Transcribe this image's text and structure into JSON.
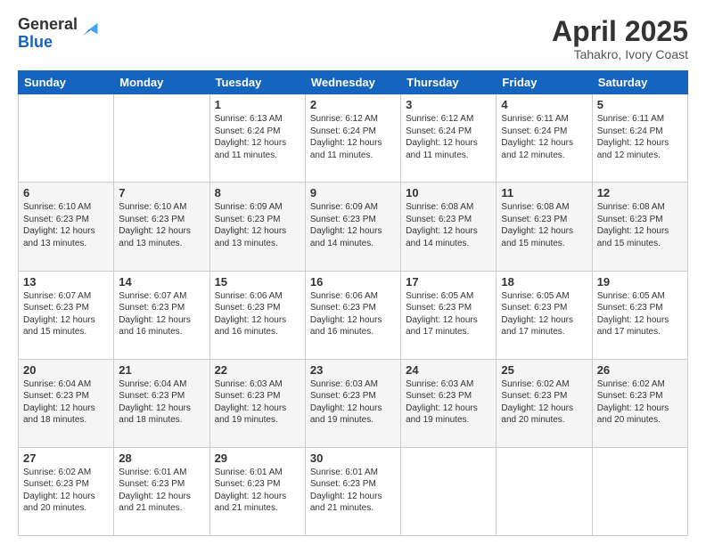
{
  "logo": {
    "general": "General",
    "blue": "Blue"
  },
  "header": {
    "month": "April 2025",
    "location": "Tahakro, Ivory Coast"
  },
  "weekdays": [
    "Sunday",
    "Monday",
    "Tuesday",
    "Wednesday",
    "Thursday",
    "Friday",
    "Saturday"
  ],
  "weeks": [
    [
      null,
      null,
      {
        "day": "1",
        "sunrise": "6:13 AM",
        "sunset": "6:24 PM",
        "daylight": "12 hours and 11 minutes."
      },
      {
        "day": "2",
        "sunrise": "6:12 AM",
        "sunset": "6:24 PM",
        "daylight": "12 hours and 11 minutes."
      },
      {
        "day": "3",
        "sunrise": "6:12 AM",
        "sunset": "6:24 PM",
        "daylight": "12 hours and 11 minutes."
      },
      {
        "day": "4",
        "sunrise": "6:11 AM",
        "sunset": "6:24 PM",
        "daylight": "12 hours and 12 minutes."
      },
      {
        "day": "5",
        "sunrise": "6:11 AM",
        "sunset": "6:24 PM",
        "daylight": "12 hours and 12 minutes."
      }
    ],
    [
      {
        "day": "6",
        "sunrise": "6:10 AM",
        "sunset": "6:23 PM",
        "daylight": "12 hours and 13 minutes."
      },
      {
        "day": "7",
        "sunrise": "6:10 AM",
        "sunset": "6:23 PM",
        "daylight": "12 hours and 13 minutes."
      },
      {
        "day": "8",
        "sunrise": "6:09 AM",
        "sunset": "6:23 PM",
        "daylight": "12 hours and 13 minutes."
      },
      {
        "day": "9",
        "sunrise": "6:09 AM",
        "sunset": "6:23 PM",
        "daylight": "12 hours and 14 minutes."
      },
      {
        "day": "10",
        "sunrise": "6:08 AM",
        "sunset": "6:23 PM",
        "daylight": "12 hours and 14 minutes."
      },
      {
        "day": "11",
        "sunrise": "6:08 AM",
        "sunset": "6:23 PM",
        "daylight": "12 hours and 15 minutes."
      },
      {
        "day": "12",
        "sunrise": "6:08 AM",
        "sunset": "6:23 PM",
        "daylight": "12 hours and 15 minutes."
      }
    ],
    [
      {
        "day": "13",
        "sunrise": "6:07 AM",
        "sunset": "6:23 PM",
        "daylight": "12 hours and 15 minutes."
      },
      {
        "day": "14",
        "sunrise": "6:07 AM",
        "sunset": "6:23 PM",
        "daylight": "12 hours and 16 minutes."
      },
      {
        "day": "15",
        "sunrise": "6:06 AM",
        "sunset": "6:23 PM",
        "daylight": "12 hours and 16 minutes."
      },
      {
        "day": "16",
        "sunrise": "6:06 AM",
        "sunset": "6:23 PM",
        "daylight": "12 hours and 16 minutes."
      },
      {
        "day": "17",
        "sunrise": "6:05 AM",
        "sunset": "6:23 PM",
        "daylight": "12 hours and 17 minutes."
      },
      {
        "day": "18",
        "sunrise": "6:05 AM",
        "sunset": "6:23 PM",
        "daylight": "12 hours and 17 minutes."
      },
      {
        "day": "19",
        "sunrise": "6:05 AM",
        "sunset": "6:23 PM",
        "daylight": "12 hours and 17 minutes."
      }
    ],
    [
      {
        "day": "20",
        "sunrise": "6:04 AM",
        "sunset": "6:23 PM",
        "daylight": "12 hours and 18 minutes."
      },
      {
        "day": "21",
        "sunrise": "6:04 AM",
        "sunset": "6:23 PM",
        "daylight": "12 hours and 18 minutes."
      },
      {
        "day": "22",
        "sunrise": "6:03 AM",
        "sunset": "6:23 PM",
        "daylight": "12 hours and 19 minutes."
      },
      {
        "day": "23",
        "sunrise": "6:03 AM",
        "sunset": "6:23 PM",
        "daylight": "12 hours and 19 minutes."
      },
      {
        "day": "24",
        "sunrise": "6:03 AM",
        "sunset": "6:23 PM",
        "daylight": "12 hours and 19 minutes."
      },
      {
        "day": "25",
        "sunrise": "6:02 AM",
        "sunset": "6:23 PM",
        "daylight": "12 hours and 20 minutes."
      },
      {
        "day": "26",
        "sunrise": "6:02 AM",
        "sunset": "6:23 PM",
        "daylight": "12 hours and 20 minutes."
      }
    ],
    [
      {
        "day": "27",
        "sunrise": "6:02 AM",
        "sunset": "6:23 PM",
        "daylight": "12 hours and 20 minutes."
      },
      {
        "day": "28",
        "sunrise": "6:01 AM",
        "sunset": "6:23 PM",
        "daylight": "12 hours and 21 minutes."
      },
      {
        "day": "29",
        "sunrise": "6:01 AM",
        "sunset": "6:23 PM",
        "daylight": "12 hours and 21 minutes."
      },
      {
        "day": "30",
        "sunrise": "6:01 AM",
        "sunset": "6:23 PM",
        "daylight": "12 hours and 21 minutes."
      },
      null,
      null,
      null
    ]
  ]
}
